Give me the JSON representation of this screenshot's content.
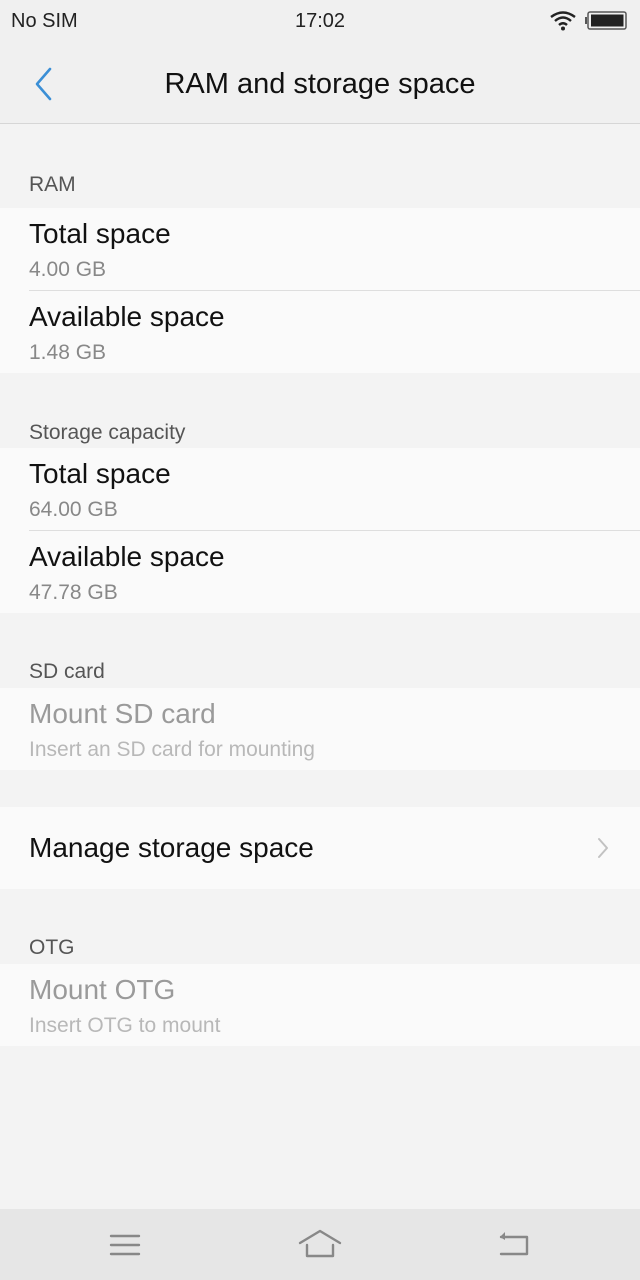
{
  "status_bar": {
    "carrier": "No SIM",
    "time": "17:02",
    "wifi_icon": "wifi-icon",
    "battery_icon": "battery-icon"
  },
  "header": {
    "back_icon": "chevron-left-icon",
    "title": "RAM and storage space"
  },
  "colors": {
    "accent": "#3b8fd6",
    "background": "#f3f3f3",
    "card": "#fafafa"
  },
  "sections": {
    "ram": {
      "label": "RAM",
      "items": [
        {
          "title": "Total space",
          "value": "4.00 GB"
        },
        {
          "title": "Available space",
          "value": "1.48 GB"
        }
      ]
    },
    "storage": {
      "label": "Storage capacity",
      "items": [
        {
          "title": "Total space",
          "value": "64.00 GB"
        },
        {
          "title": "Available space",
          "value": "47.78 GB"
        }
      ]
    },
    "sd": {
      "label": "SD card",
      "item": {
        "title": "Mount SD card",
        "subtitle": "Insert an SD card for mounting",
        "enabled": false
      }
    },
    "manage": {
      "title": "Manage storage space",
      "icon": "chevron-right-icon"
    },
    "otg": {
      "label": "OTG",
      "item": {
        "title": "Mount OTG",
        "subtitle": "Insert OTG to mount",
        "enabled": false
      }
    }
  },
  "nav_bar": {
    "menu_icon": "menu-icon",
    "home_icon": "home-icon",
    "back_icon": "back-icon"
  }
}
